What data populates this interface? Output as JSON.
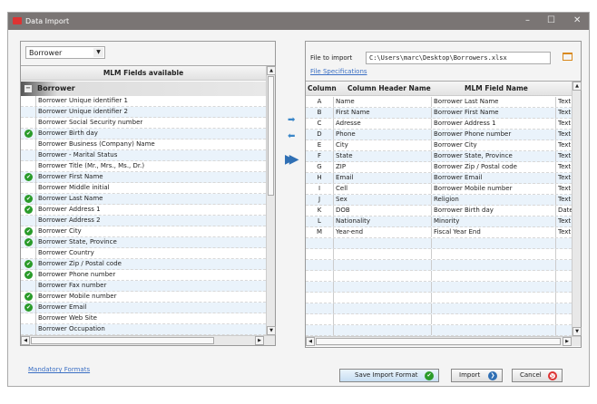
{
  "window": {
    "title": "Data Import",
    "minimize": "–",
    "maximize": "☐",
    "close": "✕"
  },
  "left": {
    "dropdown_value": "Borrower",
    "header": "MLM Fields available",
    "group": "Borrower",
    "group_toggle": "−",
    "fields": [
      {
        "label": "Borrower Unique identifier 1",
        "mapped": false
      },
      {
        "label": "Borrower Unique identifier 2",
        "mapped": false
      },
      {
        "label": "Borrower Social Security number",
        "mapped": false
      },
      {
        "label": "Borrower Birth day",
        "mapped": true
      },
      {
        "label": "Borrower Business (Company) Name",
        "mapped": false
      },
      {
        "label": "Borrower - Marital Status",
        "mapped": false
      },
      {
        "label": "Borrower Title (Mr., Mrs., Ms., Dr.)",
        "mapped": false
      },
      {
        "label": "Borrower First Name",
        "mapped": true
      },
      {
        "label": "Borrower Middle initial",
        "mapped": false
      },
      {
        "label": "Borrower Last Name",
        "mapped": true
      },
      {
        "label": "Borrower Address 1",
        "mapped": true
      },
      {
        "label": "Borrower Address 2",
        "mapped": false
      },
      {
        "label": "Borrower City",
        "mapped": true
      },
      {
        "label": "Borrower State, Province",
        "mapped": true
      },
      {
        "label": "Borrower Country",
        "mapped": false
      },
      {
        "label": "Borrower Zip / Postal code",
        "mapped": true
      },
      {
        "label": "Borrower Phone number",
        "mapped": true
      },
      {
        "label": "Borrower Fax number",
        "mapped": false
      },
      {
        "label": "Borrower Mobile number",
        "mapped": true
      },
      {
        "label": "Borrower Email",
        "mapped": true
      },
      {
        "label": "Borrower Web Site",
        "mapped": false
      },
      {
        "label": "Borrower Occupation",
        "mapped": false
      }
    ]
  },
  "right": {
    "file_label": "File to import",
    "file_value": "C:\\Users\\marc\\Desktop\\Borrowers.xlsx",
    "file_specs_link": "File Specifications",
    "columns": [
      "Column",
      "Column Header Name",
      "MLM Field Name",
      ""
    ],
    "rows": [
      [
        "A",
        "Name",
        "Borrower Last Name",
        "Text"
      ],
      [
        "B",
        "First Name",
        "Borrower First Name",
        "Text"
      ],
      [
        "C",
        "Adresse",
        "Borrower Address 1",
        "Text"
      ],
      [
        "D",
        "Phone",
        "Borrower Phone number",
        "Text"
      ],
      [
        "E",
        "City",
        "Borrower City",
        "Text"
      ],
      [
        "F",
        "State",
        "Borrower State, Province",
        "Text"
      ],
      [
        "G",
        "ZIP",
        "Borrower Zip / Postal code",
        "Text"
      ],
      [
        "H",
        "Email",
        "Borrower Email",
        "Text"
      ],
      [
        "I",
        "Cell",
        "Borrower Mobile number",
        "Text"
      ],
      [
        "J",
        "Sex",
        "Religion",
        "Text"
      ],
      [
        "K",
        "DOB",
        "Borrower Birth day",
        "Date"
      ],
      [
        "L",
        "Nationality",
        "Minority",
        "Text"
      ],
      [
        "M",
        "Year-end",
        "Fiscal Year End",
        "Text"
      ]
    ]
  },
  "footer": {
    "mandatory_link": "Mandatory Formats",
    "save_label": "Save Import Format",
    "import_label": "Import",
    "cancel_label": "Cancel"
  },
  "colors": {
    "titlebar": "#7a7574",
    "check": "#2a9b2a",
    "arrow": "#3a86c8",
    "link": "#3b6fc4"
  }
}
